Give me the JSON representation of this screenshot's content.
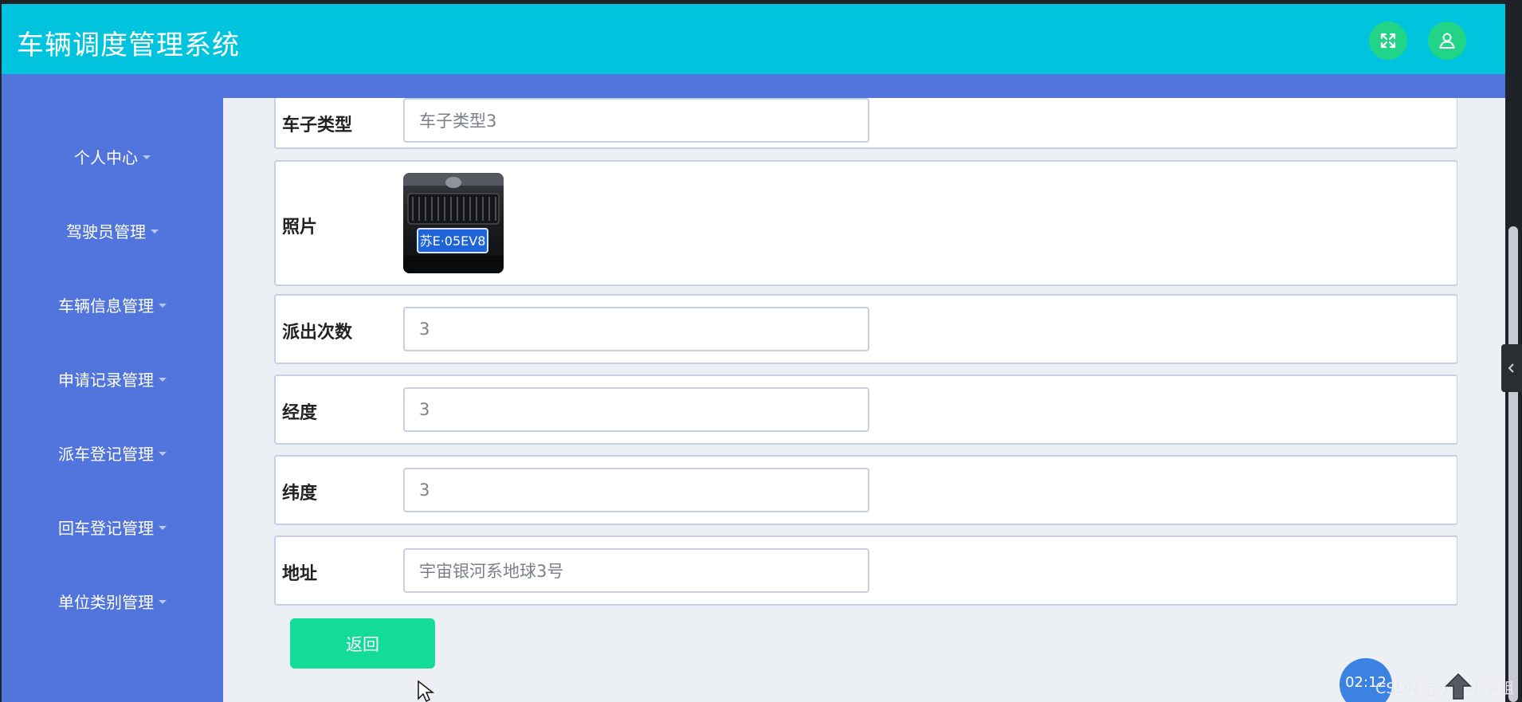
{
  "header": {
    "title": "车辆调度管理系统",
    "fullscreen_icon": "expand-arrows-icon",
    "user_icon": "user-icon"
  },
  "sidebar": {
    "items": [
      {
        "label": "个人中心"
      },
      {
        "label": "驾驶员管理"
      },
      {
        "label": "车辆信息管理"
      },
      {
        "label": "申请记录管理"
      },
      {
        "label": "派车登记管理"
      },
      {
        "label": "回车登记管理"
      },
      {
        "label": "单位类别管理"
      }
    ]
  },
  "form": {
    "car_type": {
      "label": "车子类型",
      "value": "车子类型3"
    },
    "photo": {
      "label": "照片",
      "plate_text": "苏E·05EV8"
    },
    "dispatch_count": {
      "label": "派出次数",
      "value": "3"
    },
    "longitude": {
      "label": "经度",
      "value": "3"
    },
    "latitude": {
      "label": "纬度",
      "value": "3"
    },
    "address": {
      "label": "地址",
      "value": "宇宙银河系地球3号"
    }
  },
  "actions": {
    "back_label": "返回"
  },
  "overlay": {
    "timer": "02:12",
    "watermark": "CSDN @小小小学姐"
  },
  "colors": {
    "header_bg": "#00c4de",
    "sidebar_bg": "#5174dd",
    "header_button": "#21d487",
    "back_button": "#13dc98",
    "content_bg": "#eceff3"
  }
}
